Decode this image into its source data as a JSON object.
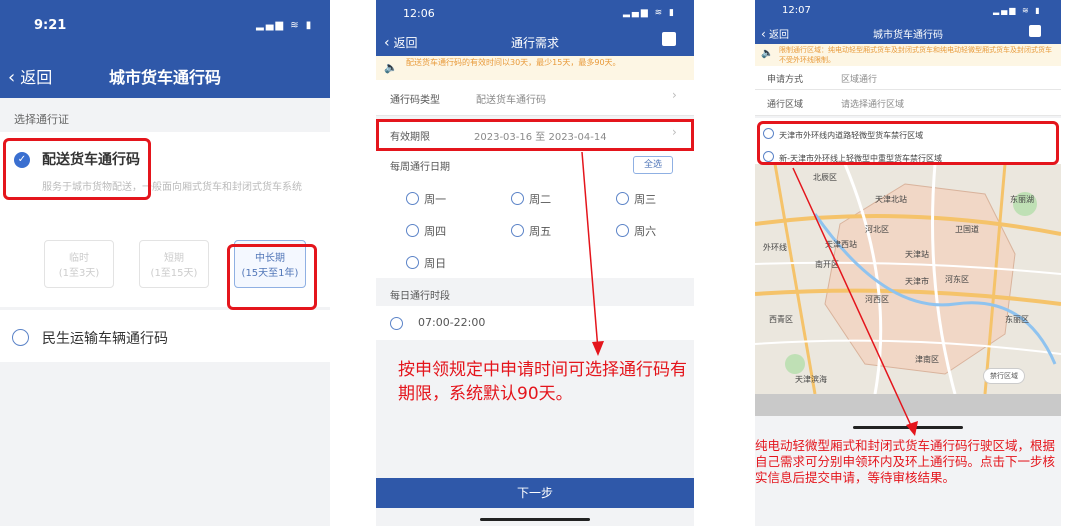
{
  "phone1": {
    "time": "9:21",
    "status_icons": "▂▄▆ ≋ ▮",
    "back": "返回",
    "title": "城市货车通行码",
    "section_label": "选择通行证",
    "option1_label": "配送货车通行码",
    "option1_desc": "服务于城市货物配送，一般面向厢式货车和封闭式货车系统",
    "durations": [
      {
        "title": "临时",
        "sub": "(1至3天)"
      },
      {
        "title": "短期",
        "sub": "(1至15天)"
      },
      {
        "title": "中长期",
        "sub": "(15天至1年)"
      }
    ],
    "option2_label": "民生运输车辆通行码"
  },
  "phone2": {
    "time": "12:06",
    "back": "返回",
    "title": "通行需求",
    "notice": "配送货车通行码的有效时间以30天，最少15天，最多90天。",
    "type_label": "通行码类型",
    "type_value": "配送货车通行码",
    "validity_label": "有效期限",
    "validity_value": "2023-03-16 至 2023-04-14",
    "weekly_label": "每周通行日期",
    "select_all": "全选",
    "days": [
      "周一",
      "周二",
      "周三",
      "周四",
      "周五",
      "周六",
      "周日"
    ],
    "daily_label": "每日通行时段",
    "time_slot": "07:00-22:00",
    "next_button": "下一步",
    "annotation": "按申领规定中申请时间可选择通行码有期限，系统默认90天。"
  },
  "phone3": {
    "time": "12:07",
    "back": "返回",
    "title": "城市货车通行码",
    "notice": "限制通行区域：纯电动轻型厢式货车及封闭式货车和纯电动轻微型厢式货车及封闭式货车不受外环线限制。",
    "method_label": "申请方式",
    "method_value": "区域通行",
    "area_label": "通行区域",
    "area_value": "请选择通行区域",
    "area_options": [
      "天津市外环线内道路轻微型货车禁行区域",
      "新-天津市外环线上轻微型中重型货车禁行区域"
    ],
    "map_labels": [
      "北辰区",
      "天津北站",
      "东丽区",
      "河北区",
      "天津站",
      "南开区",
      "河东区",
      "河西区",
      "天津市",
      "西青区",
      "卫国道",
      "天津西站",
      "外环线",
      "津南区",
      "东丽湖",
      "天津滨海"
    ],
    "map_button": "禁行区域",
    "annotation": "纯电动轻微型厢式和封闭式货车通行码行驶区域，根据自己需求可分别申领环内及环上通行码。点击下一步核实信息后提交申请，等待审核结果。"
  }
}
